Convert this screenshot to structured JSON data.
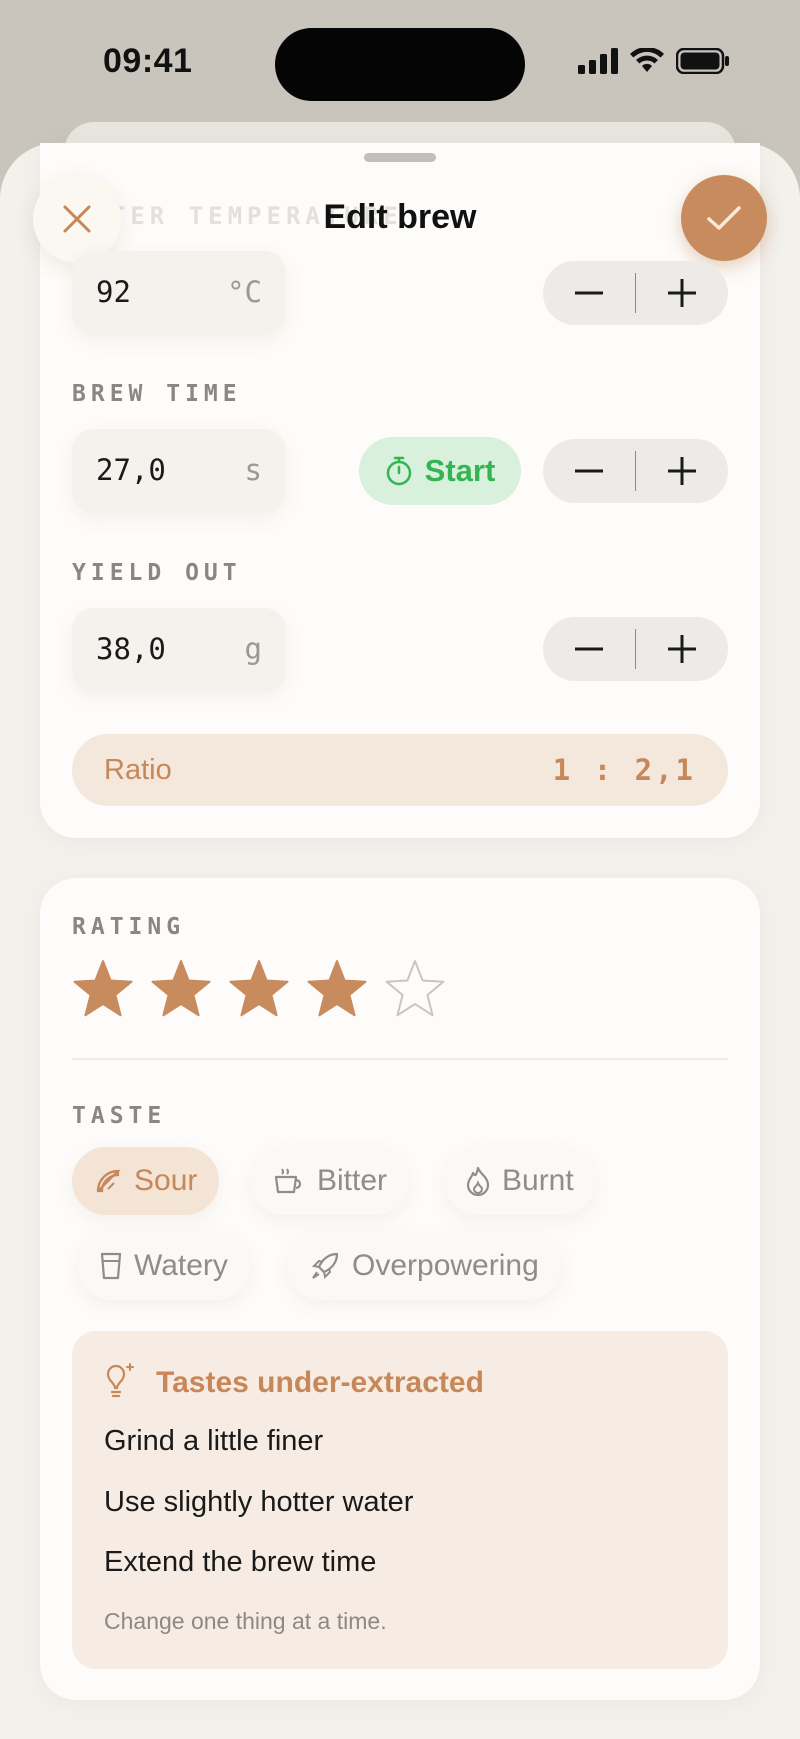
{
  "status_bar": {
    "time": "09:41"
  },
  "header": {
    "title": "Edit brew",
    "close": "close",
    "confirm": "confirm"
  },
  "ghost_label": "WATER TEMPERATURE",
  "fields": {
    "temperature": {
      "value": "92",
      "unit": "°C"
    },
    "brew_time": {
      "label": "BREW TIME",
      "value": "27,0",
      "unit": "s",
      "start_label": "Start"
    },
    "yield_out": {
      "label": "YIELD OUT",
      "value": "38,0",
      "unit": "g"
    }
  },
  "ratio": {
    "label": "Ratio",
    "value": "1 : 2,1"
  },
  "rating": {
    "label": "RATING",
    "value": 4,
    "max": 5
  },
  "taste": {
    "label": "TASTE",
    "options": [
      {
        "label": "Sour",
        "icon": "lemon-icon",
        "selected": true
      },
      {
        "label": "Bitter",
        "icon": "cup-icon",
        "selected": false
      },
      {
        "label": "Burnt",
        "icon": "flame-icon",
        "selected": false
      },
      {
        "label": "Watery",
        "icon": "glass-icon",
        "selected": false
      },
      {
        "label": "Overpowering",
        "icon": "rocket-icon",
        "selected": false
      }
    ]
  },
  "advice": {
    "title": "Tastes under-extracted",
    "tips": [
      "Grind a little finer",
      "Use slightly hotter water",
      "Extend the brew time"
    ],
    "note": "Change one thing at a time."
  },
  "colors": {
    "accent": "#c88b5e",
    "start_green": "#34b554",
    "background": "#f3f1ec"
  }
}
